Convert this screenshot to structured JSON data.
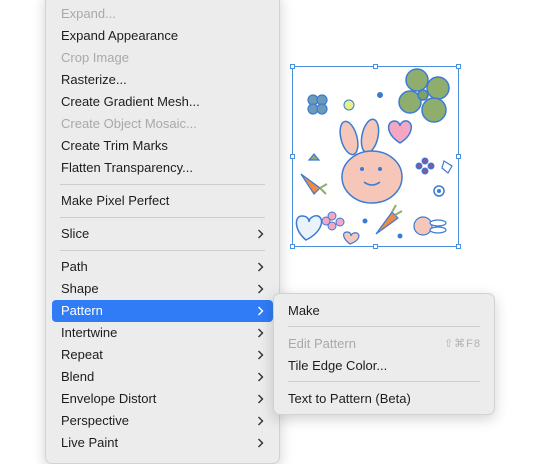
{
  "menu": {
    "items": [
      {
        "label": "Expand...",
        "disabled": true
      },
      {
        "label": "Expand Appearance"
      },
      {
        "label": "Crop Image",
        "disabled": true
      },
      {
        "label": "Rasterize..."
      },
      {
        "label": "Create Gradient Mesh..."
      },
      {
        "label": "Create Object Mosaic...",
        "disabled": true
      },
      {
        "label": "Create Trim Marks"
      },
      {
        "label": "Flatten Transparency..."
      },
      {
        "label": "Make Pixel Perfect"
      },
      {
        "label": "Slice",
        "submenu": true
      },
      {
        "label": "Path",
        "submenu": true
      },
      {
        "label": "Shape",
        "submenu": true
      },
      {
        "label": "Pattern",
        "submenu": true,
        "highlighted": true
      },
      {
        "label": "Intertwine",
        "submenu": true
      },
      {
        "label": "Repeat",
        "submenu": true
      },
      {
        "label": "Blend",
        "submenu": true
      },
      {
        "label": "Envelope Distort",
        "submenu": true
      },
      {
        "label": "Perspective",
        "submenu": true
      },
      {
        "label": "Live Paint",
        "submenu": true
      }
    ]
  },
  "submenu": {
    "items": [
      {
        "label": "Make"
      },
      {
        "label": "Edit Pattern",
        "disabled": true,
        "shortcut": "⇧⌘F8"
      },
      {
        "label": "Tile Edge Color..."
      },
      {
        "label": "Text to Pattern (Beta)"
      }
    ]
  },
  "colors": {
    "menu_bg": "#ececec",
    "highlight": "#2f7cf6",
    "disabled_text": "#a9a9a9",
    "selection": "#4a8fe0",
    "bunny_pink": "#f6c6b8",
    "clover_green": "#8fae6e",
    "heart_pink": "#f4a7c4",
    "carrot_orange": "#ee8a45",
    "outline_blue": "#3a7bd5"
  },
  "icons": [
    "chevron-right-icon",
    "bunny-icon",
    "clover-icon",
    "heart-icon",
    "carrot-icon",
    "flower-icon"
  ]
}
